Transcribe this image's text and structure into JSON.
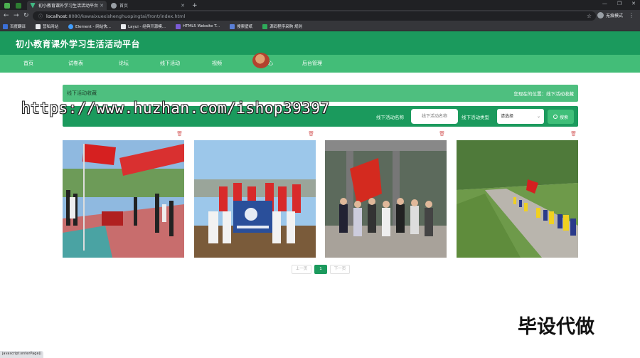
{
  "browser": {
    "tabs": [
      {
        "label": "",
        "color": "#3c8d3c"
      },
      {
        "label": "初小教育课外学习生活活动平台",
        "color": "#41b883"
      },
      {
        "label": "首页",
        "color": "#9aa0a6"
      }
    ],
    "url_host": "localhost",
    "url_rest": ":8080/kewaixuexishenghuopingtai/front/index.html",
    "incognito_label": "无痕模式",
    "bookmarks": [
      {
        "label": "百度翻译",
        "color": "#3b6fd6"
      },
      {
        "label": "营私网站",
        "color": "#e8eaed"
      },
      {
        "label": "Element - 网站快...",
        "color": "#409eff"
      },
      {
        "label": "Layui - 经典开源模...",
        "color": "#e8eaed"
      },
      {
        "label": "HTML5 Website T...",
        "color": "#7b5cd6"
      },
      {
        "label": "搜索壁纸",
        "color": "#5a7fd6"
      },
      {
        "label": "源码程序采购 规则",
        "color": "#2eaa5a"
      }
    ]
  },
  "site": {
    "title": "初小教育课外学习生活活动平台",
    "nav": [
      "首页",
      "试卷表",
      "论坛",
      "线下活动",
      "视频",
      "个人中心",
      "后台管理"
    ]
  },
  "crumb": {
    "title": "线下活动收藏",
    "location": "您现在的位置：线下活动收藏"
  },
  "search": {
    "name_label": "线下活动名称",
    "name_placeholder": "线下活动名称",
    "type_label": "线下活动类型",
    "type_selected": "请选择",
    "button_label": "搜索"
  },
  "cards": [
    {
      "delete_icon": "trash-icon"
    },
    {
      "delete_icon": "trash-icon"
    },
    {
      "delete_icon": "trash-icon"
    },
    {
      "delete_icon": "trash-icon"
    }
  ],
  "pager": {
    "prev": "上一页",
    "current": "1",
    "next": "下一页"
  },
  "watermark": "https://www.huzhan.com/ishop39397",
  "corner_mark": "毕设代做",
  "status": "javascript:enterPage()"
}
